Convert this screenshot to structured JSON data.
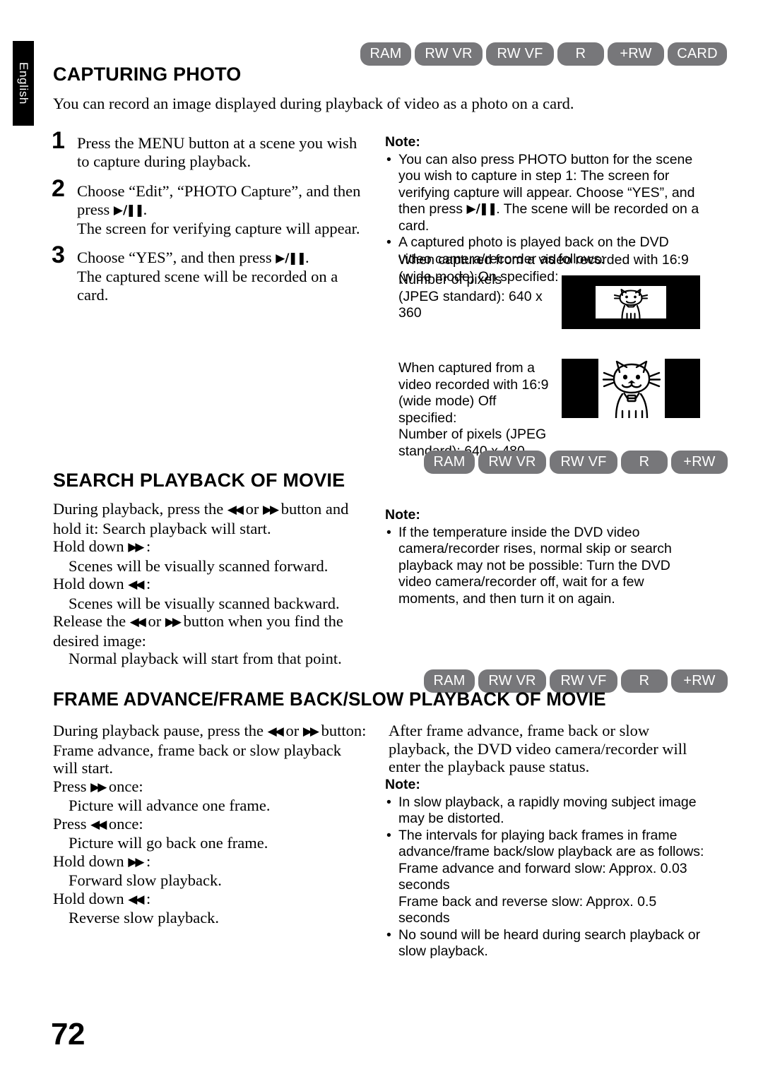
{
  "page": {
    "number": "72",
    "language_tab": "English"
  },
  "icons": {
    "play_pause": "▶/❙❙",
    "rewind": "◀◀",
    "fast_forward": "▶▶"
  },
  "badges": {
    "capturing_photo": [
      "RAM",
      "RW VR",
      "RW VF",
      "R",
      "+RW",
      "CARD"
    ],
    "search_playback": [
      "RAM",
      "RW VR",
      "RW VF",
      "R",
      "+RW"
    ],
    "frame_advance": [
      "RAM",
      "RW VR",
      "RW VF",
      "R",
      "+RW"
    ]
  },
  "sections": {
    "capturing_photo": {
      "title": "CAPTURING PHOTO",
      "intro": "You can record an image displayed during playback of video as a photo on a card.",
      "steps": [
        {
          "num": "1",
          "text": "Press the MENU button at a scene you wish to capture during playback.",
          "detail": ""
        },
        {
          "num": "2",
          "text_before_icon": "Choose “Edit”, “PHOTO Capture”, and then press ",
          "text_after_icon": ".",
          "detail": "The screen for verifying capture will appear."
        },
        {
          "num": "3",
          "text_before_icon": "Choose “YES”, and then press ",
          "text_after_icon": ".",
          "detail": "The captured scene will be recorded on a card."
        }
      ],
      "note": {
        "label": "Note:",
        "items": [
          {
            "part1": "You can also press PHOTO button for the scene you wish to capture in step 1: The screen for verifying capture will appear. Choose “YES”, and then press ",
            "part2": ". The scene will be recorded on a card."
          },
          {
            "part1": "A captured photo is played back on the DVD video camera/recorder as follows:",
            "part2": ""
          }
        ],
        "wide_on": {
          "line1": "When captured from a video recorded with 16:9 (wide mode) On specified:",
          "line2": "Number of pixels (JPEG standard): 640 x 360"
        },
        "wide_off": {
          "line1": "When captured from a video recorded with 16:9 (wide mode) Off specified:",
          "line2": "Number of pixels (JPEG standard): 640 x 480"
        }
      }
    },
    "search_playback": {
      "title": "SEARCH PLAYBACK OF MOVIE",
      "body": {
        "intro_before": "During playback, press the ",
        "intro_middle": " or ",
        "intro_after": " button and hold it: Search playback will start.",
        "lines": [
          {
            "label_before": "Hold down ",
            "label_after": " :",
            "indent": "Scenes will be visually scanned forward."
          },
          {
            "label_before": "Hold down ",
            "label_after": " :",
            "indent": "Scenes will be visually scanned backward."
          }
        ],
        "release_before": "Release the ",
        "release_middle": " or ",
        "release_after": " button when you find the desired image:",
        "release_indent": "Normal playback will start from that point."
      },
      "note": {
        "label": "Note:",
        "items": [
          "If the temperature inside the DVD video camera/recorder rises, normal skip or search playback may not be possible: Turn the DVD video camera/recorder off, wait for a few moments, and then turn it on again."
        ]
      }
    },
    "frame_advance": {
      "title": "FRAME ADVANCE/FRAME BACK/SLOW PLAYBACK OF MOVIE",
      "left": {
        "intro_before": "During playback pause, press the ",
        "intro_middle": " or ",
        "intro_after": " button: Frame advance, frame back or slow playback will start.",
        "lines": [
          {
            "label_before": "Press ",
            "label_after": " once:",
            "indent": "Picture will advance one frame."
          },
          {
            "label_before": "Press ",
            "label_after": " once:",
            "indent": "Picture will go back one frame."
          },
          {
            "label_before": "Hold down ",
            "label_after": " :",
            "indent": "Forward slow playback."
          },
          {
            "label_before": "Hold down ",
            "label_after": " :",
            "indent": "Reverse slow playback."
          }
        ]
      },
      "right": {
        "paragraph": "After frame advance, frame back or slow playback, the DVD video camera/recorder will enter the playback pause status."
      },
      "note": {
        "label": "Note:",
        "items": [
          {
            "main": "In slow playback, a rapidly moving subject image may be distorted.",
            "extra1": "",
            "extra2": ""
          },
          {
            "main": "The intervals for playing back frames in frame advance/frame back/slow playback are as follows:",
            "extra1": "Frame advance and forward slow: Approx. 0.03 seconds",
            "extra2": "Frame back and reverse slow: Approx. 0.5 seconds"
          },
          {
            "main": "No sound will be heard during search playback or slow playback.",
            "extra1": "",
            "extra2": ""
          }
        ]
      }
    }
  }
}
